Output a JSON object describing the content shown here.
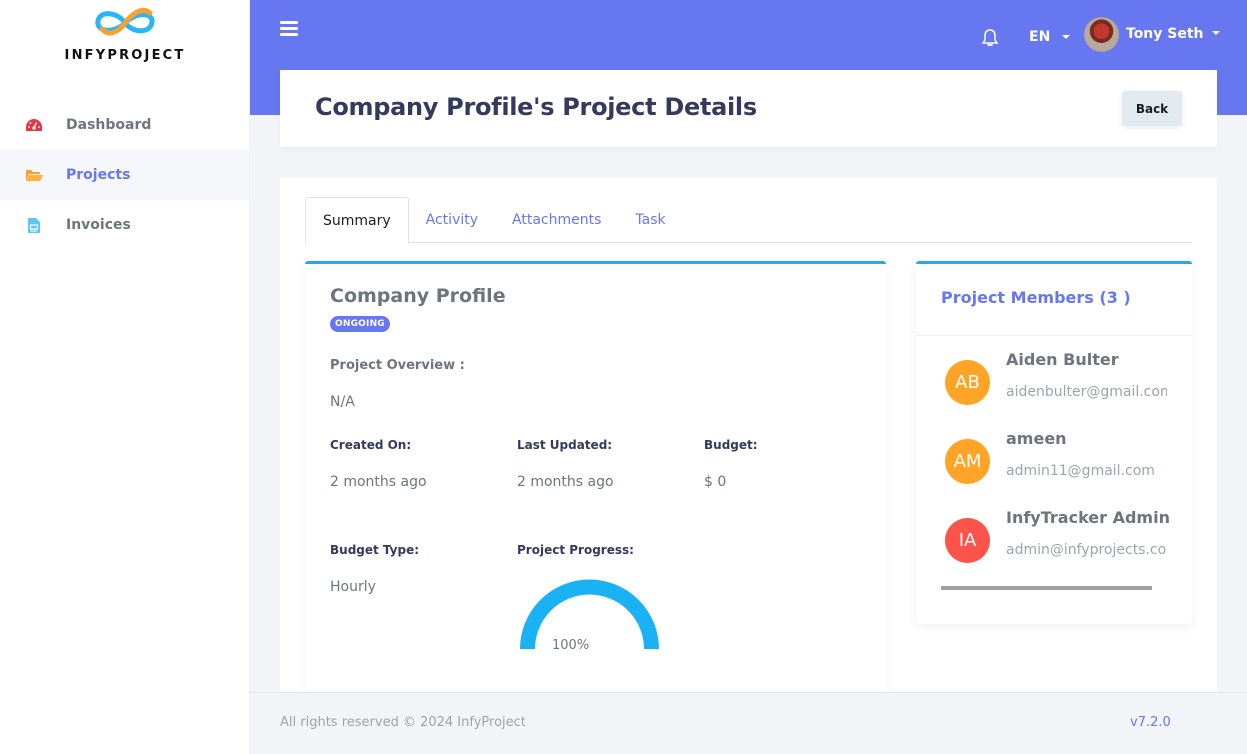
{
  "brand": {
    "name": "INFYPROJECT"
  },
  "sidebar": {
    "items": [
      {
        "label": "Dashboard",
        "icon": "dashboard-gauge-icon",
        "active": false
      },
      {
        "label": "Projects",
        "icon": "folder-open-icon",
        "active": true
      },
      {
        "label": "Invoices",
        "icon": "invoice-file-icon",
        "active": false
      }
    ]
  },
  "header": {
    "language": "EN",
    "user_name": "Tony Seth"
  },
  "page": {
    "title": "Company Profile's Project Details",
    "back_label": "Back"
  },
  "tabs": [
    {
      "label": "Summary",
      "active": true
    },
    {
      "label": "Activity",
      "active": false
    },
    {
      "label": "Attachments",
      "active": false
    },
    {
      "label": "Task",
      "active": false
    }
  ],
  "project": {
    "name": "Company Profile",
    "status": "ONGOING",
    "overview_label": "Project Overview :",
    "overview_value": "N/A",
    "created_label": "Created On:",
    "created_value": "2 months ago",
    "updated_label": "Last Updated:",
    "updated_value": "2 months ago",
    "budget_label": "Budget:",
    "budget_value": "$ 0",
    "budget_type_label": "Budget Type:",
    "budget_type_value": "Hourly",
    "progress_label": "Project Progress:",
    "progress_text": "100%",
    "progress_fraction": 1.0
  },
  "members": {
    "title": "Project Members (3 )",
    "list": [
      {
        "initials": "AB",
        "name": "Aiden Bulter",
        "email": "aidenbulter@gmail.com",
        "color": "#ffa426"
      },
      {
        "initials": "AM",
        "name": "ameen",
        "email": "admin11@gmail.com",
        "color": "#ffa426"
      },
      {
        "initials": "IA",
        "name": "InfyTracker Admin",
        "email": "admin@infyprojects.com",
        "color": "#fc544b"
      }
    ]
  },
  "footer": {
    "copyright": "All rights reserved © 2024 InfyProject",
    "version": "v7.2.0"
  },
  "colors": {
    "primary": "#6777ef",
    "info": "#26a8e6",
    "gauge": "#1ab2f5"
  }
}
